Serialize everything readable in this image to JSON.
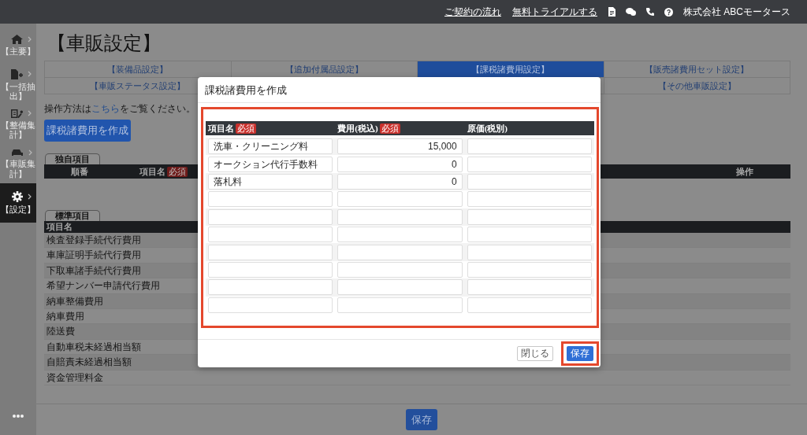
{
  "top_bar": {
    "links": [
      "ご契約の流れ",
      "無料トライアルする"
    ],
    "company": "株式会社 ABCモータース"
  },
  "sidebar": {
    "items": [
      {
        "label": "【主要】",
        "selected": false
      },
      {
        "label": "【一括抽出】",
        "selected": false
      },
      {
        "label": "【整備集計】",
        "selected": false
      },
      {
        "label": "【車販集計】",
        "selected": false
      },
      {
        "label": "【設定】",
        "selected": true
      }
    ]
  },
  "page": {
    "title": "【車販設定】",
    "tab_rows": [
      [
        {
          "label": "【装備品設定】",
          "selected": false
        },
        {
          "label": "【追加付属品設定】",
          "selected": false
        },
        {
          "label": "【課税諸費用設定】",
          "selected": true
        },
        {
          "label": "【販売諸費用セット設定】",
          "selected": false
        }
      ],
      [
        {
          "label": "【車販ステータス設定】",
          "selected": false
        },
        {},
        {},
        {
          "label": "【その他車販設定】",
          "selected": false
        }
      ]
    ],
    "help_text": {
      "before": "操作方法は",
      "link": "こちら",
      "after": "をご覧ください。"
    },
    "create_button": "課税諸費用を作成",
    "custom_section": {
      "label": "独自項目",
      "columns": [
        {
          "label": "順番"
        },
        {
          "label": "項目名",
          "badge": "必須"
        },
        {
          "label": "操作"
        }
      ]
    },
    "standard_section": {
      "label": "標準項目",
      "column": "項目名",
      "rows": [
        "検査登録手続代行費用",
        "車庫証明手続代行費用",
        "下取車諸手続代行費用",
        "希望ナンバー申請代行費用",
        "納車整備費用",
        "納車費用",
        "陸送費",
        "自動車税未経過相当額",
        "自賠責未経過相当額",
        "資金管理料金"
      ]
    },
    "save_button": "保存"
  },
  "modal": {
    "title": "課税諸費用を作成",
    "table": {
      "highlighted": true,
      "columns": [
        {
          "label": "項目名",
          "badge": "必須"
        },
        {
          "label": "費用(税込)",
          "badge": "必須"
        },
        {
          "label": "原価(税別)"
        }
      ],
      "rows": [
        {
          "name": "洗車・クリーニング料",
          "cost": "15,000"
        },
        {
          "name": "オークション代行手数料",
          "cost": "0"
        },
        {
          "name": "落札料",
          "cost": "0"
        },
        {},
        {},
        {},
        {},
        {},
        {},
        {}
      ]
    },
    "buttons": [
      {
        "label": "閉じる",
        "kind": "secondary",
        "highlighted": false
      },
      {
        "label": "保存",
        "kind": "primary",
        "highlighted": true
      }
    ]
  }
}
